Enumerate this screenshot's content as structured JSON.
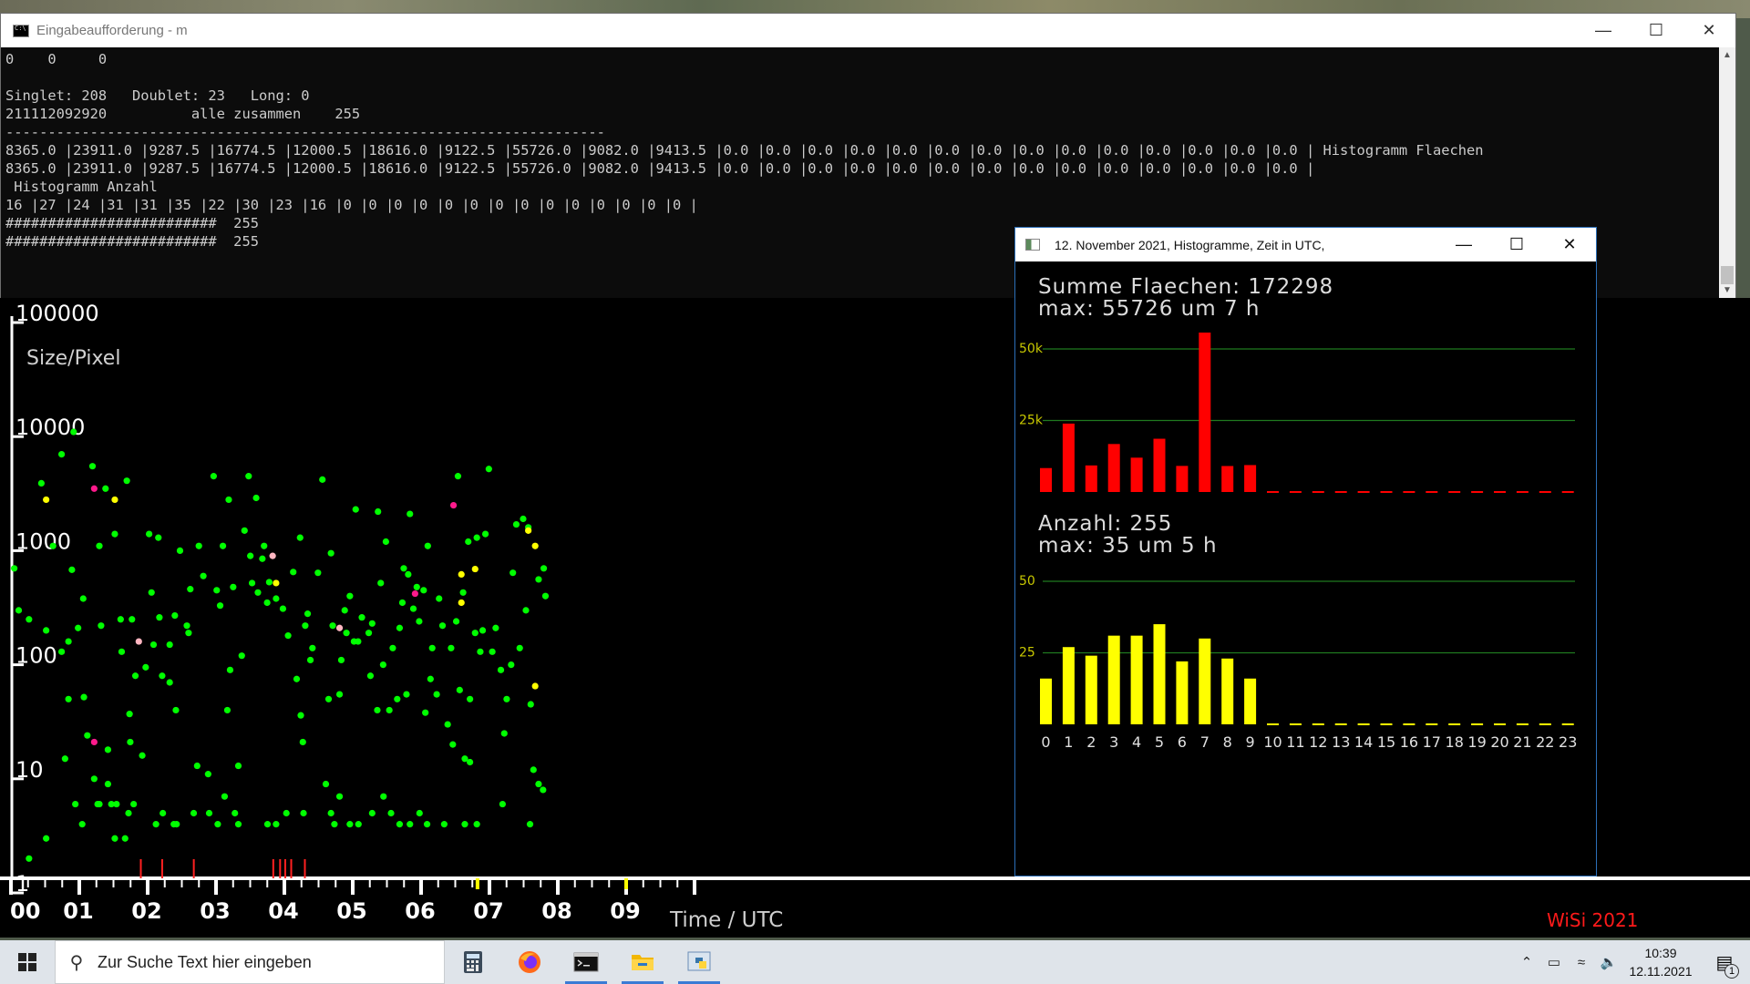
{
  "cmd_window": {
    "title": "Eingabeaufforderung - m",
    "lines": [
      "0    0     0",
      "",
      "Singlet: 208   Doublet: 23   Long: 0",
      "211112092920          alle zusammen    255",
      "-----------------------------------------------------------------------",
      "8365.0 |23911.0 |9287.5 |16774.5 |12000.5 |18616.0 |9122.5 |55726.0 |9082.0 |9413.5 |0.0 |0.0 |0.0 |0.0 |0.0 |0.0 |0.0 |0.0 |0.0 |0.0 |0.0 |0.0 |0.0 |0.0 | Histogramm Flaechen",
      "8365.0 |23911.0 |9287.5 |16774.5 |12000.5 |18616.0 |9122.5 |55726.0 |9082.0 |9413.5 |0.0 |0.0 |0.0 |0.0 |0.0 |0.0 |0.0 |0.0 |0.0 |0.0 |0.0 |0.0 |0.0 |0.0 |",
      " Histogramm Anzahl",
      "16 |27 |24 |31 |31 |35 |22 |30 |23 |16 |0 |0 |0 |0 |0 |0 |0 |0 |0 |0 |0 |0 |0 |0 |",
      "#########################  255",
      "#########################  255"
    ]
  },
  "hist_window": {
    "title": "12. November 2021, Histogramme, Zeit in UTC,",
    "area_title": "Summe Flaechen: 172298",
    "area_max": "max: 55726 um 7 h",
    "count_title": "Anzahl: 255",
    "count_max": "max: 35 um 5 h",
    "area_ticks": [
      "50k",
      "25k"
    ],
    "count_ticks": [
      "50",
      "25"
    ],
    "hours": [
      "0",
      "1",
      "2",
      "3",
      "4",
      "5",
      "6",
      "7",
      "8",
      "9",
      "10",
      "11",
      "12",
      "13",
      "14",
      "15",
      "16",
      "17",
      "18",
      "19",
      "20",
      "21",
      "22",
      "23"
    ],
    "colors": {
      "area": "#ff0000",
      "count": "#ffff00",
      "grid": "#1f7a1f"
    }
  },
  "chart_data": [
    {
      "type": "bar",
      "title": "Summe Flaechen: 172298",
      "categories": [
        "0",
        "1",
        "2",
        "3",
        "4",
        "5",
        "6",
        "7",
        "8",
        "9",
        "10",
        "11",
        "12",
        "13",
        "14",
        "15",
        "16",
        "17",
        "18",
        "19",
        "20",
        "21",
        "22",
        "23"
      ],
      "values": [
        8365.0,
        23911.0,
        9287.5,
        16774.5,
        12000.5,
        18616.0,
        9122.5,
        55726.0,
        9082.0,
        9413.5,
        0,
        0,
        0,
        0,
        0,
        0,
        0,
        0,
        0,
        0,
        0,
        0,
        0,
        0
      ],
      "ylim": [
        0,
        55000
      ]
    },
    {
      "type": "bar",
      "title": "Anzahl: 255",
      "categories": [
        "0",
        "1",
        "2",
        "3",
        "4",
        "5",
        "6",
        "7",
        "8",
        "9",
        "10",
        "11",
        "12",
        "13",
        "14",
        "15",
        "16",
        "17",
        "18",
        "19",
        "20",
        "21",
        "22",
        "23"
      ],
      "values": [
        16,
        27,
        24,
        31,
        31,
        35,
        22,
        30,
        23,
        16,
        0,
        0,
        0,
        0,
        0,
        0,
        0,
        0,
        0,
        0,
        0,
        0,
        0,
        0
      ],
      "ylim": [
        0,
        55
      ]
    },
    {
      "type": "scatter",
      "xlabel": "Time  /  UTC",
      "ylabel": "Size/Pixel",
      "yscale": "log",
      "ylim": [
        1,
        100000
      ],
      "xlim": [
        0,
        15.5
      ],
      "y_ticks": [
        "100000",
        "10000",
        "1000",
        "100",
        "10",
        "1"
      ],
      "x_ticks": [
        "00",
        "01",
        "02",
        "03",
        "04",
        "05",
        "06",
        "07",
        "08",
        "09"
      ],
      "colors": {
        "green": "#00ff00",
        "yellow": "#ffff00",
        "magenta": "#ff1a8c",
        "pink": "#ffb6c1",
        "signature": "#ff0000"
      },
      "series": [
        {
          "name": "",
          "color": "green",
          "points": [
            [
              0.07,
              700
            ],
            [
              0.2,
              300
            ],
            [
              0.5,
              250
            ],
            [
              0.86,
              3900
            ],
            [
              1.0,
              200
            ],
            [
              1.2,
              1100
            ],
            [
              1.45,
              130
            ],
            [
              1.45,
              7000
            ],
            [
              1.55,
              15
            ],
            [
              1.65,
              160
            ],
            [
              1.65,
              50
            ],
            [
              1.75,
              680
            ],
            [
              1.8,
              11000
            ],
            [
              1.93,
              210
            ],
            [
              2.08,
              380
            ],
            [
              2.1,
              52
            ],
            [
              2.2,
              24
            ],
            [
              2.35,
              5500
            ],
            [
              2.4,
              10
            ],
            [
              2.55,
              1100
            ],
            [
              2.6,
              220
            ],
            [
              2.73,
              3500
            ],
            [
              2.8,
              18
            ],
            [
              2.8,
              9
            ],
            [
              3.0,
              1400
            ],
            [
              3.17,
              250
            ],
            [
              3.2,
              130
            ],
            [
              3.35,
              4100
            ],
            [
              3.43,
              37
            ],
            [
              3.45,
              21
            ],
            [
              3.5,
              250
            ],
            [
              3.6,
              80
            ],
            [
              3.8,
              16
            ],
            [
              3.9,
              95
            ],
            [
              4.0,
              1400
            ],
            [
              4.07,
              430
            ],
            [
              4.13,
              150
            ],
            [
              4.27,
              1300
            ],
            [
              4.3,
              260
            ],
            [
              4.38,
              80
            ],
            [
              4.6,
              70
            ],
            [
              4.6,
              150
            ],
            [
              4.75,
              270
            ],
            [
              4.78,
              40
            ],
            [
              4.9,
              1000
            ],
            [
              5.1,
              220
            ],
            [
              5.15,
              190
            ],
            [
              5.2,
              460
            ],
            [
              5.4,
              13
            ],
            [
              5.45,
              1100
            ],
            [
              5.58,
              600
            ],
            [
              5.72,
              11
            ],
            [
              5.88,
              4500
            ],
            [
              5.97,
              450
            ],
            [
              6.07,
              330
            ],
            [
              6.15,
              1100
            ],
            [
              6.28,
              40
            ],
            [
              6.32,
              2800
            ],
            [
              6.36,
              90
            ],
            [
              6.45,
              480
            ],
            [
              6.6,
              13
            ],
            [
              6.7,
              120
            ],
            [
              6.78,
              1500
            ],
            [
              6.9,
              4500
            ],
            [
              6.95,
              900
            ],
            [
              7.0,
              520
            ],
            [
              7.12,
              2900
            ],
            [
              7.17,
              430
            ],
            [
              7.3,
              850
            ],
            [
              7.35,
              1100
            ],
            [
              7.44,
              350
            ],
            [
              7.5,
              530
            ],
            [
              7.7,
              380
            ],
            [
              7.9,
              310
            ],
            [
              8.05,
              180
            ],
            [
              8.2,
              650
            ],
            [
              8.3,
              75
            ],
            [
              8.4,
              1300
            ],
            [
              8.42,
              36
            ],
            [
              8.48,
              21
            ],
            [
              8.55,
              220
            ],
            [
              8.62,
              280
            ],
            [
              8.7,
              110
            ],
            [
              8.76,
              140
            ],
            [
              8.92,
              640
            ],
            [
              9.05,
              4200
            ],
            [
              9.15,
              9
            ],
            [
              9.23,
              50
            ],
            [
              9.3,
              950
            ],
            [
              9.35,
              220
            ],
            [
              9.55,
              55
            ],
            [
              9.6,
              110
            ],
            [
              9.7,
              300
            ],
            [
              9.75,
              190
            ],
            [
              9.85,
              400
            ],
            [
              9.97,
              160
            ],
            [
              10.02,
              2300
            ],
            [
              10.09,
              160
            ],
            [
              10.2,
              260
            ],
            [
              10.4,
              190
            ],
            [
              10.45,
              80
            ],
            [
              10.5,
              230
            ],
            [
              10.65,
              40
            ],
            [
              10.67,
              2200
            ],
            [
              10.75,
              520
            ],
            [
              10.82,
              100
            ],
            [
              10.9,
              1200
            ],
            [
              11.0,
              40
            ],
            [
              11.1,
              140
            ],
            [
              11.23,
              50
            ],
            [
              11.3,
              210
            ],
            [
              11.38,
              350
            ],
            [
              11.42,
              700
            ],
            [
              11.5,
              55
            ],
            [
              11.55,
              620
            ],
            [
              11.6,
              2100
            ],
            [
              11.7,
              310
            ],
            [
              11.8,
              480
            ],
            [
              11.87,
              240
            ],
            [
              12.0,
              450
            ],
            [
              12.05,
              38
            ],
            [
              12.12,
              1100
            ],
            [
              12.2,
              75
            ],
            [
              12.25,
              140
            ],
            [
              12.38,
              55
            ],
            [
              12.45,
              380
            ],
            [
              12.55,
              220
            ],
            [
              12.7,
              30
            ],
            [
              12.8,
              140
            ],
            [
              12.85,
              20
            ],
            [
              12.95,
              240
            ],
            [
              13.0,
              4500
            ],
            [
              13.05,
              60
            ],
            [
              13.15,
              430
            ],
            [
              13.2,
              15
            ],
            [
              13.3,
              1200
            ],
            [
              13.35,
              50
            ],
            [
              13.5,
              190
            ],
            [
              13.55,
              1300
            ],
            [
              13.65,
              130
            ],
            [
              13.72,
              200
            ],
            [
              13.8,
              1400
            ],
            [
              13.9,
              5200
            ],
            [
              14.0,
              130
            ],
            [
              14.1,
              210
            ],
            [
              14.25,
              90
            ],
            [
              14.35,
              25
            ],
            [
              14.42,
              50
            ],
            [
              14.55,
              100
            ],
            [
              14.6,
              640
            ],
            [
              14.7,
              1700
            ],
            [
              14.8,
              140
            ],
            [
              14.9,
              1900
            ],
            [
              14.98,
              300
            ],
            [
              15.05,
              1600
            ],
            [
              15.12,
              45
            ],
            [
              15.2,
              12
            ],
            [
              15.35,
              560
            ],
            [
              15.5,
              700
            ],
            [
              15.55,
              400
            ],
            [
              3.05,
              6
            ],
            [
              3.4,
              5
            ],
            [
              3.55,
              6
            ],
            [
              4.2,
              4
            ],
            [
              4.4,
              5
            ],
            [
              4.8,
              4
            ],
            [
              5.3,
              5
            ],
            [
              5.75,
              5
            ],
            [
              6.0,
              4
            ],
            [
              6.2,
              7
            ],
            [
              6.5,
              5
            ],
            [
              7.7,
              4
            ],
            [
              8.0,
              5
            ],
            [
              8.5,
              5
            ],
            [
              9.3,
              5
            ],
            [
              9.55,
              7
            ],
            [
              9.85,
              4
            ],
            [
              10.5,
              5
            ],
            [
              10.83,
              7
            ],
            [
              11.05,
              5
            ],
            [
              11.6,
              4
            ],
            [
              11.88,
              5
            ],
            [
              12.1,
              4
            ],
            [
              13.35,
              14
            ],
            [
              13.2,
              4
            ],
            [
              13.55,
              4
            ],
            [
              14.3,
              6
            ],
            [
              15.48,
              8
            ],
            [
              15.35,
              9
            ],
            [
              15.1,
              4
            ],
            [
              1.85,
              6
            ],
            [
              2.05,
              4
            ],
            [
              2.5,
              6
            ],
            [
              2.55,
              6
            ],
            [
              3.0,
              3
            ],
            [
              3.3,
              3
            ],
            [
              1.0,
              3
            ],
            [
              0.5,
              2
            ],
            [
              2.9,
              6
            ],
            [
              4.72,
              4
            ],
            [
              12.6,
              4
            ],
            [
              11.3,
              4
            ],
            [
              10.1,
              4
            ],
            [
              9.4,
              4
            ],
            [
              7.45,
              4
            ],
            [
              6.6,
              4
            ]
          ]
        },
        {
          "name": "",
          "color": "yellow",
          "points": [
            [
              1.0,
              2800
            ],
            [
              3.0,
              2800
            ],
            [
              7.7,
              520
            ],
            [
              13.1,
              620
            ],
            [
              13.1,
              350
            ],
            [
              13.5,
              690
            ],
            [
              15.05,
              1500
            ],
            [
              15.25,
              1100
            ],
            [
              15.25,
              65
            ]
          ]
        },
        {
          "name": "",
          "color": "magenta",
          "points": [
            [
              2.4,
              3500
            ],
            [
              2.4,
              21
            ],
            [
              12.87,
              2500
            ],
            [
              11.75,
              420
            ]
          ]
        },
        {
          "name": "",
          "color": "pink",
          "points": [
            [
              3.7,
              160
            ],
            [
              7.6,
              900
            ],
            [
              9.55,
              210
            ]
          ]
        }
      ]
    }
  ],
  "plot_window": {
    "y_ticks": [
      "100000",
      "10000",
      "1000",
      "100",
      "10",
      "1"
    ],
    "y_label": "Size/Pixel",
    "x_ticks": [
      "00",
      "01",
      "02",
      "03",
      "04",
      "05",
      "06",
      "07",
      "08",
      "09"
    ],
    "x_label": "Time  /  UTC",
    "signature": "WiSi 2021"
  },
  "taskbar": {
    "search_placeholder": "Zur Suche Text hier eingeben",
    "time": "10:39",
    "date": "12.11.2021",
    "notification_count": "1",
    "apps": [
      "calculator-icon",
      "firefox-icon",
      "terminal-icon",
      "explorer-icon",
      "python-icon"
    ]
  }
}
